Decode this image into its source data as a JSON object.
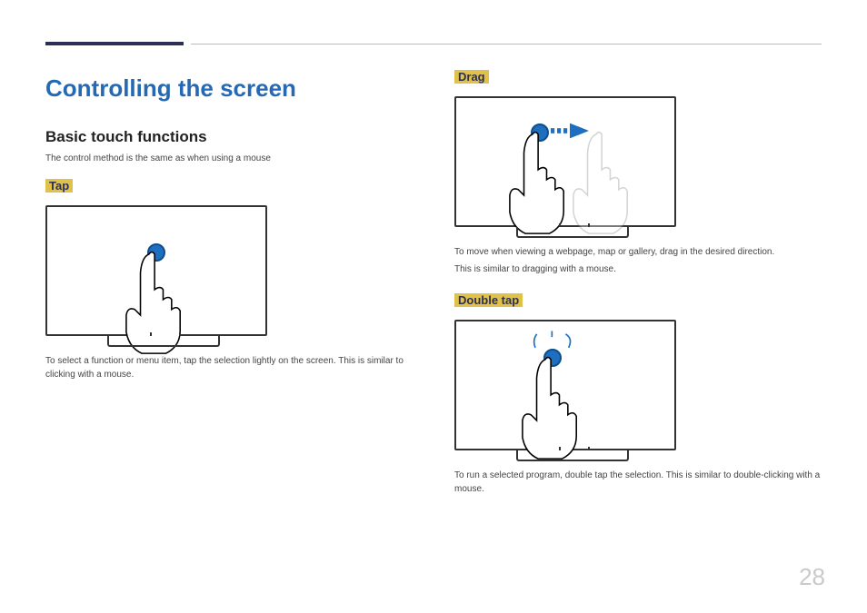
{
  "section_title": "Controlling the screen",
  "subsection_title": "Basic touch functions",
  "intro": "The control method is the same as when using a mouse",
  "gestures": {
    "tap": {
      "label": "Tap",
      "desc": "To select a function or menu item, tap the selection lightly on the screen. This is similar to clicking with a mouse."
    },
    "drag": {
      "label": "Drag",
      "desc1": "To move when viewing a webpage, map or gallery, drag in the desired direction.",
      "desc2": "This is similar to dragging with a mouse."
    },
    "doubletap": {
      "label": "Double tap",
      "desc": "To run a selected program, double tap the selection. This is similar to double-clicking with a mouse."
    }
  },
  "page_number": "28"
}
